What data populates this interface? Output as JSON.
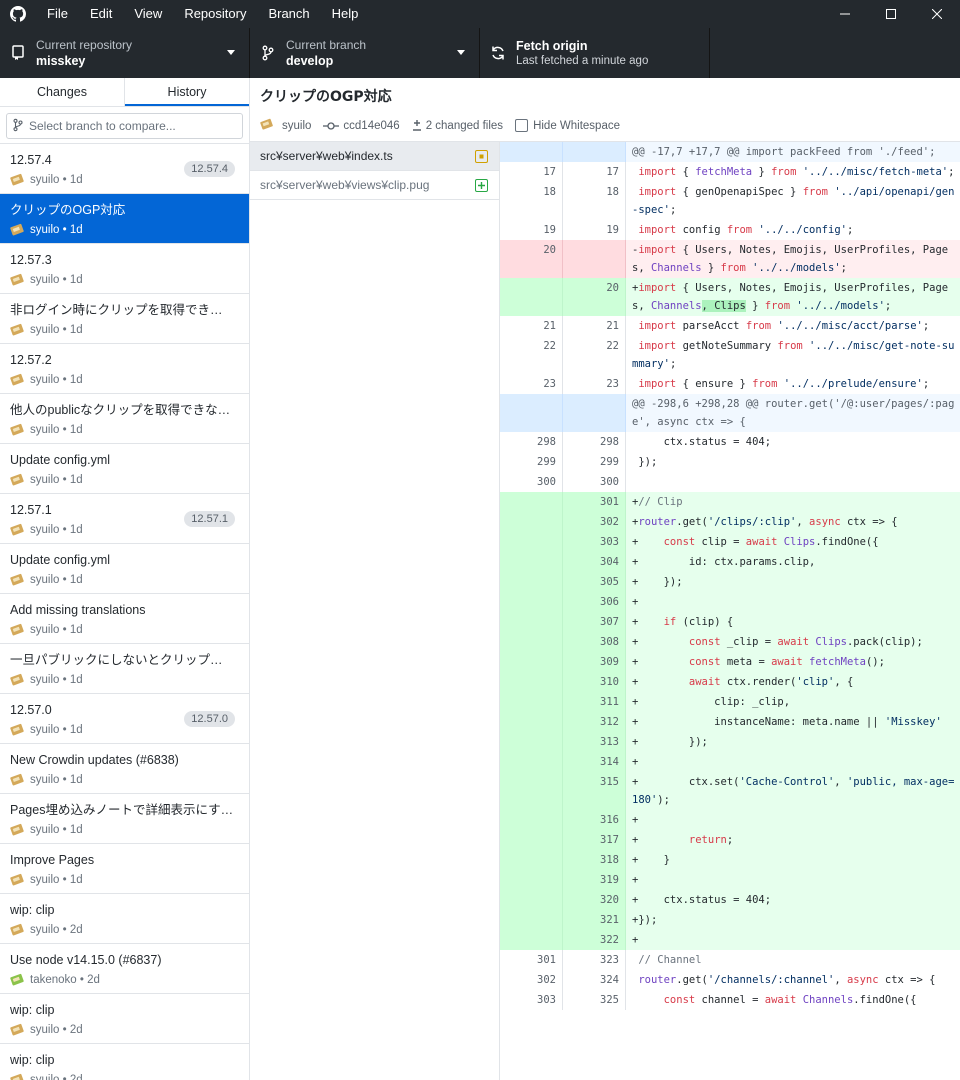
{
  "menu": [
    "File",
    "Edit",
    "View",
    "Repository",
    "Branch",
    "Help"
  ],
  "toolbar": {
    "repo_caption": "Current repository",
    "repo_name": "misskey",
    "branch_caption": "Current branch",
    "branch_name": "develop",
    "fetch_label": "Fetch origin",
    "fetch_sub": "Last fetched a minute ago"
  },
  "sidebar": {
    "tab_changes": "Changes",
    "tab_history": "History",
    "compare_placeholder": "Select branch to compare...",
    "commits": [
      {
        "title": "12.57.4",
        "author": "syuilo",
        "time": "1d",
        "tag": "12.57.4"
      },
      {
        "title": "クリップのOGP対応",
        "author": "syuilo",
        "time": "1d",
        "tag": ""
      },
      {
        "title": "12.57.3",
        "author": "syuilo",
        "time": "1d",
        "tag": ""
      },
      {
        "title": "非ログイン時にクリップを取得できない問題を...",
        "author": "syuilo",
        "time": "1d",
        "tag": ""
      },
      {
        "title": "12.57.2",
        "author": "syuilo",
        "time": "1d",
        "tag": ""
      },
      {
        "title": "他人のpublicなクリップを取得できない問題...",
        "author": "syuilo",
        "time": "1d",
        "tag": ""
      },
      {
        "title": "Update config.yml",
        "author": "syuilo",
        "time": "1d",
        "tag": ""
      },
      {
        "title": "12.57.1",
        "author": "syuilo",
        "time": "1d",
        "tag": "12.57.1"
      },
      {
        "title": "Update config.yml",
        "author": "syuilo",
        "time": "1d",
        "tag": ""
      },
      {
        "title": "Add missing translations",
        "author": "syuilo",
        "time": "1d",
        "tag": ""
      },
      {
        "title": "一旦パブリックにしないとクリップ作成できな...",
        "author": "syuilo",
        "time": "1d",
        "tag": ""
      },
      {
        "title": "12.57.0",
        "author": "syuilo",
        "time": "1d",
        "tag": "12.57.0"
      },
      {
        "title": "New Crowdin updates (#6838)",
        "author": "syuilo",
        "time": "1d",
        "tag": ""
      },
      {
        "title": "Pages埋め込みノートで詳細表示にするかど...",
        "author": "syuilo",
        "time": "1d",
        "tag": ""
      },
      {
        "title": "Improve Pages",
        "author": "syuilo",
        "time": "1d",
        "tag": ""
      },
      {
        "title": "wip: clip",
        "author": "syuilo",
        "time": "2d",
        "tag": ""
      },
      {
        "title": "Use node v14.15.0 (#6837)",
        "author": "takenoko",
        "time": "2d",
        "tag": ""
      },
      {
        "title": "wip: clip",
        "author": "syuilo",
        "time": "2d",
        "tag": ""
      },
      {
        "title": "wip: clip",
        "author": "syuilo",
        "time": "2d",
        "tag": ""
      }
    ]
  },
  "commit": {
    "title": "クリップのOGP対応",
    "author": "syuilo",
    "sha": "ccd14e046",
    "changed_files": "2 changed files",
    "hide_whitespace": "Hide Whitespace"
  },
  "files": [
    {
      "path": "src¥server¥web¥index.ts",
      "status": "modified"
    },
    {
      "path": "src¥server¥web¥views¥clip.pug",
      "status": "added"
    }
  ],
  "diff": [
    {
      "type": "hunk",
      "old": "",
      "new": "",
      "code": "@@ -17,7 +17,7 @@ import packFeed from './feed';"
    },
    {
      "type": "ctx",
      "old": "17",
      "new": "17",
      "code": " import { fetchMeta } from '../../misc/fetch-meta';"
    },
    {
      "type": "ctx",
      "old": "18",
      "new": "18",
      "code": " import { genOpenapiSpec } from '../api/openapi/gen-spec';"
    },
    {
      "type": "ctx",
      "old": "19",
      "new": "19",
      "code": " import config from '../../config';"
    },
    {
      "type": "del",
      "old": "20",
      "new": "",
      "code": "-import { Users, Notes, Emojis, UserProfiles, Pages, Channels } from '../../models';"
    },
    {
      "type": "add",
      "old": "",
      "new": "20",
      "code": "+import { Users, Notes, Emojis, UserProfiles, Pages, Channels, Clips } from '../../models';"
    },
    {
      "type": "ctx",
      "old": "21",
      "new": "21",
      "code": " import parseAcct from '../../misc/acct/parse';"
    },
    {
      "type": "ctx",
      "old": "22",
      "new": "22",
      "code": " import getNoteSummary from '../../misc/get-note-summary';"
    },
    {
      "type": "ctx",
      "old": "23",
      "new": "23",
      "code": " import { ensure } from '../../prelude/ensure';"
    },
    {
      "type": "hunk",
      "old": "",
      "new": "",
      "code": "@@ -298,6 +298,28 @@ router.get('/@:user/pages/:page', async ctx => {"
    },
    {
      "type": "ctx",
      "old": "298",
      "new": "298",
      "code": " \tctx.status = 404;"
    },
    {
      "type": "ctx",
      "old": "299",
      "new": "299",
      "code": " });"
    },
    {
      "type": "ctx",
      "old": "300",
      "new": "300",
      "code": ""
    },
    {
      "type": "add",
      "old": "",
      "new": "301",
      "code": "+// Clip"
    },
    {
      "type": "add",
      "old": "",
      "new": "302",
      "code": "+router.get('/clips/:clip', async ctx => {"
    },
    {
      "type": "add",
      "old": "",
      "new": "303",
      "code": "+\tconst clip = await Clips.findOne({"
    },
    {
      "type": "add",
      "old": "",
      "new": "304",
      "code": "+\t\tid: ctx.params.clip,"
    },
    {
      "type": "add",
      "old": "",
      "new": "305",
      "code": "+\t});"
    },
    {
      "type": "add",
      "old": "",
      "new": "306",
      "code": "+"
    },
    {
      "type": "add",
      "old": "",
      "new": "307",
      "code": "+\tif (clip) {"
    },
    {
      "type": "add",
      "old": "",
      "new": "308",
      "code": "+\t\tconst _clip = await Clips.pack(clip);"
    },
    {
      "type": "add",
      "old": "",
      "new": "309",
      "code": "+\t\tconst meta = await fetchMeta();"
    },
    {
      "type": "add",
      "old": "",
      "new": "310",
      "code": "+\t\tawait ctx.render('clip', {"
    },
    {
      "type": "add",
      "old": "",
      "new": "311",
      "code": "+\t\t\tclip: _clip,"
    },
    {
      "type": "add",
      "old": "",
      "new": "312",
      "code": "+\t\t\tinstanceName: meta.name || 'Misskey'"
    },
    {
      "type": "add",
      "old": "",
      "new": "313",
      "code": "+\t\t});"
    },
    {
      "type": "add",
      "old": "",
      "new": "314",
      "code": "+"
    },
    {
      "type": "add",
      "old": "",
      "new": "315",
      "code": "+\t\tctx.set('Cache-Control', 'public, max-age=180');"
    },
    {
      "type": "add",
      "old": "",
      "new": "316",
      "code": "+"
    },
    {
      "type": "add",
      "old": "",
      "new": "317",
      "code": "+\t\treturn;"
    },
    {
      "type": "add",
      "old": "",
      "new": "318",
      "code": "+\t}"
    },
    {
      "type": "add",
      "old": "",
      "new": "319",
      "code": "+"
    },
    {
      "type": "add",
      "old": "",
      "new": "320",
      "code": "+\tctx.status = 404;"
    },
    {
      "type": "add",
      "old": "",
      "new": "321",
      "code": "+});"
    },
    {
      "type": "add",
      "old": "",
      "new": "322",
      "code": "+"
    },
    {
      "type": "ctx",
      "old": "301",
      "new": "323",
      "code": " // Channel"
    },
    {
      "type": "ctx",
      "old": "302",
      "new": "324",
      "code": " router.get('/channels/:channel', async ctx => {"
    },
    {
      "type": "ctx",
      "old": "303",
      "new": "325",
      "code": " \tconst channel = await Channels.findOne({"
    }
  ],
  "colors": {
    "accent": "#0366d6",
    "titlebar": "#24292e",
    "modified": "#d0a000",
    "added": "#28a745"
  }
}
